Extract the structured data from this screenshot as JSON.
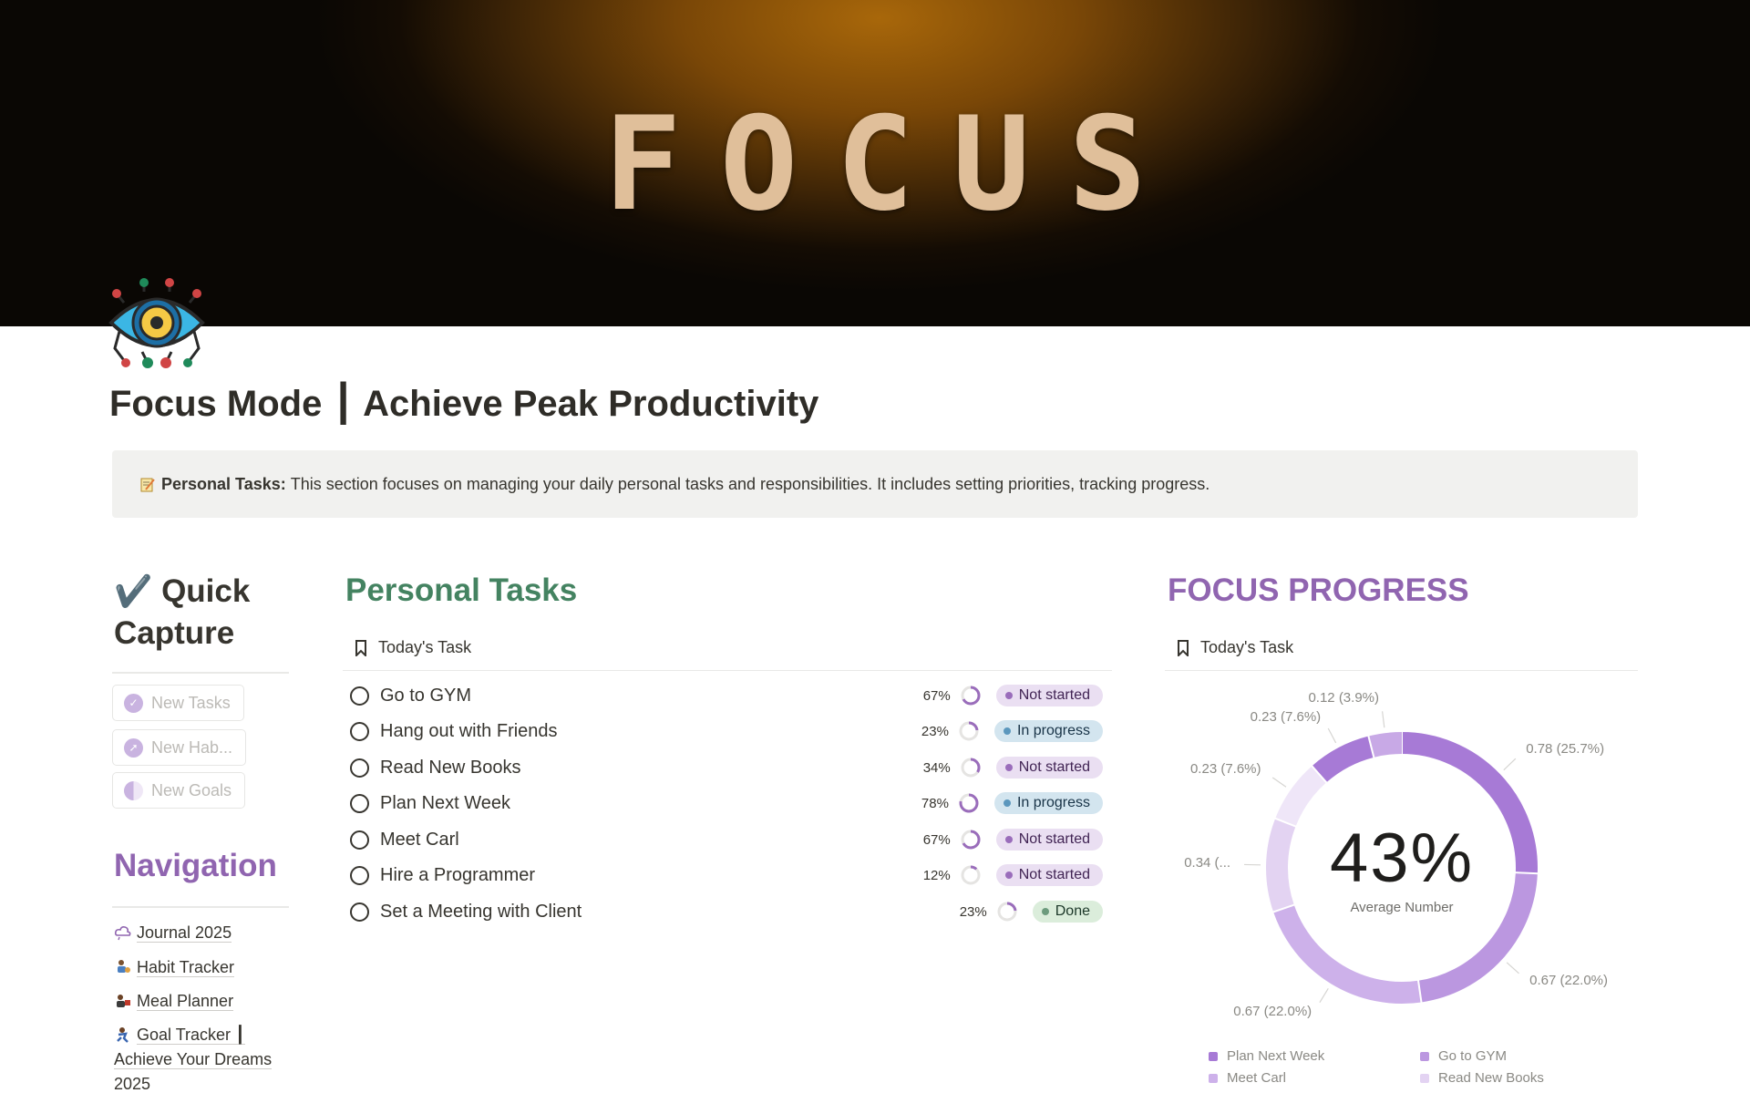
{
  "cover": {
    "word": "FOCUS"
  },
  "page": {
    "title": "Focus Mode ┃ Achieve Peak Productivity"
  },
  "callout": {
    "label": "Personal Tasks:",
    "text": "This section focuses on managing your daily personal tasks and responsibilities. It includes setting priorities, tracking progress."
  },
  "quick_capture": {
    "check": "✔️",
    "title": "Quick Capture",
    "buttons": [
      {
        "label": "New Tasks",
        "icon": "checkmark-badge-icon"
      },
      {
        "label": "New Hab...",
        "icon": "compass-icon"
      },
      {
        "label": "New Goals",
        "icon": "half-circle-icon"
      }
    ]
  },
  "navigation": {
    "title": "Navigation",
    "links": [
      {
        "label": "Journal 2025",
        "icon": "cloud-icon"
      },
      {
        "label": "Habit Tracker",
        "icon": "person-icon"
      },
      {
        "label": "Meal Planner",
        "icon": "chef-icon"
      },
      {
        "label": "Goal Tracker ┃ Achieve Your Dreams 2025",
        "icon": "runner-icon"
      }
    ]
  },
  "personal_tasks": {
    "title": "Personal Tasks",
    "view": "Today's Task",
    "tasks": [
      {
        "name": "Go to GYM",
        "percent": "67%",
        "progress": 0.67,
        "status": "Not started"
      },
      {
        "name": "Hang out with Friends",
        "percent": "23%",
        "progress": 0.23,
        "status": "In progress"
      },
      {
        "name": "Read New Books",
        "percent": "34%",
        "progress": 0.34,
        "status": "Not started"
      },
      {
        "name": "Plan Next Week",
        "percent": "78%",
        "progress": 0.78,
        "status": "In progress"
      },
      {
        "name": "Meet Carl",
        "percent": "67%",
        "progress": 0.67,
        "status": "Not started"
      },
      {
        "name": "Hire a Programmer",
        "percent": "12%",
        "progress": 0.12,
        "status": "Not started"
      },
      {
        "name": "Set a Meeting with Client",
        "percent": "23%",
        "progress": 0.23,
        "status": "Done"
      }
    ]
  },
  "focus_progress": {
    "title": "FOCUS PROGRESS",
    "view": "Today's Task",
    "center_value": "43%",
    "center_label": "Average Number"
  },
  "chart_data": {
    "type": "pie",
    "subtype": "donut",
    "slices": [
      {
        "label": "Plan Next Week",
        "value": 0.78,
        "display": "0.78 (25.7%)",
        "color": "#a77ad6"
      },
      {
        "label": "Go to GYM",
        "value": 0.67,
        "display": "0.67 (22.0%)",
        "color": "#bb97e0"
      },
      {
        "label": "Meet Carl",
        "value": 0.67,
        "display": "0.67 (22.0%)",
        "color": "#cdb1ea"
      },
      {
        "label": "Read New Books",
        "value": 0.34,
        "display": "0.34 (...",
        "color": "#e3d3f2"
      },
      {
        "label": "Hang out with Friends",
        "value": 0.23,
        "display": "0.23 (7.6%)",
        "color": "#efe6f8"
      },
      {
        "label": "Set a Meeting with Client",
        "value": 0.23,
        "display": "0.23 (7.6%)",
        "color": "#a77ad6"
      },
      {
        "label": "Hire a Programmer",
        "value": 0.12,
        "display": "0.12 (3.9%)",
        "color": "#c8a9e6"
      }
    ],
    "legend_position": "bottom",
    "legend_visible": [
      "Plan Next Week",
      "Go to GYM",
      "Meet Carl",
      "Read New Books"
    ]
  }
}
